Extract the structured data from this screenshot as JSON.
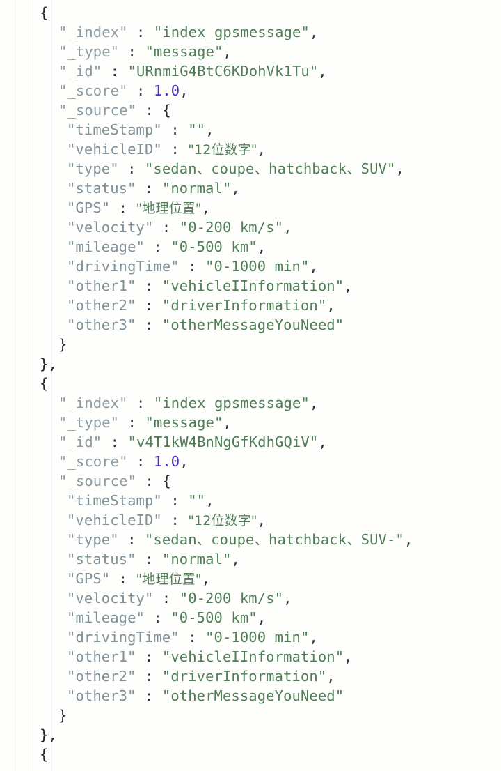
{
  "viewer": {
    "name": "json-result-viewer",
    "language": "json",
    "background_color": "#fefffd",
    "colors": {
      "key": "#8b9aa3",
      "key_nested": "#7f9098",
      "string": "#4f7d55",
      "number": "#4b2bc4",
      "punctuation": "#2d3338",
      "brace": "#22282d",
      "indent_guide": "#eef0f1"
    }
  },
  "documents": [
    {
      "open_brace": "{",
      "fields": [
        {
          "key": "\"_index\"",
          "colon": " : ",
          "value": "\"index_gpsmessage\"",
          "comma": ",",
          "kind": "string"
        },
        {
          "key": "\"_type\"",
          "colon": " : ",
          "value": "\"message\"",
          "comma": ",",
          "kind": "string"
        },
        {
          "key": "\"_id\"",
          "colon": " : ",
          "value": "\"URnmiG4BtC6KDohVk1Tu\"",
          "comma": ",",
          "kind": "string"
        },
        {
          "key": "\"_score\"",
          "colon": " : ",
          "value": "1.0",
          "comma": ",",
          "kind": "number"
        },
        {
          "key": "\"_source\"",
          "colon": " : ",
          "value": "{",
          "comma": "",
          "kind": "object-open"
        }
      ],
      "source": [
        {
          "key": "\"timeStamp\"",
          "colon": " : ",
          "value": "\"\"",
          "comma": ",",
          "kind": "string"
        },
        {
          "key": "\"vehicleID\"",
          "colon": " : ",
          "value": "\"12位数字\"",
          "comma": ",",
          "kind": "string-cjk"
        },
        {
          "key": "\"type\"",
          "colon": " : ",
          "value": "\"sedan、coupe、hatchback、SUV\"",
          "comma": ",",
          "kind": "string"
        },
        {
          "key": "\"status\"",
          "colon": " : ",
          "value": "\"normal\"",
          "comma": ",",
          "kind": "string"
        },
        {
          "key": "\"GPS\"",
          "colon": " : ",
          "value": "\"地理位置\"",
          "comma": ",",
          "kind": "string-cjk"
        },
        {
          "key": "\"velocity\"",
          "colon": " : ",
          "value": "\"0-200 km/s\"",
          "comma": ",",
          "kind": "string"
        },
        {
          "key": "\"mileage\"",
          "colon": " : ",
          "value": "\"0-500 km\"",
          "comma": ",",
          "kind": "string"
        },
        {
          "key": "\"drivingTime\"",
          "colon": " : ",
          "value": "\"0-1000 min\"",
          "comma": ",",
          "kind": "string"
        },
        {
          "key": "\"other1\"",
          "colon": " : ",
          "value": "\"vehicleIInformation\"",
          "comma": ",",
          "kind": "string"
        },
        {
          "key": "\"other2\"",
          "colon": " : ",
          "value": "\"driverInformation\"",
          "comma": ",",
          "kind": "string"
        },
        {
          "key": "\"other3\"",
          "colon": " : ",
          "value": "\"otherMessageYouNeed\"",
          "comma": "",
          "kind": "string"
        }
      ],
      "source_close": "}",
      "close_brace": "},"
    },
    {
      "open_brace": "{",
      "fields": [
        {
          "key": "\"_index\"",
          "colon": " : ",
          "value": "\"index_gpsmessage\"",
          "comma": ",",
          "kind": "string"
        },
        {
          "key": "\"_type\"",
          "colon": " : ",
          "value": "\"message\"",
          "comma": ",",
          "kind": "string"
        },
        {
          "key": "\"_id\"",
          "colon": " : ",
          "value": "\"v4T1kW4BnNgGfKdhGQiV\"",
          "comma": ",",
          "kind": "string"
        },
        {
          "key": "\"_score\"",
          "colon": " : ",
          "value": "1.0",
          "comma": ",",
          "kind": "number"
        },
        {
          "key": "\"_source\"",
          "colon": " : ",
          "value": "{",
          "comma": "",
          "kind": "object-open"
        }
      ],
      "source": [
        {
          "key": "\"timeStamp\"",
          "colon": " : ",
          "value": "\"\"",
          "comma": ",",
          "kind": "string"
        },
        {
          "key": "\"vehicleID\"",
          "colon": " : ",
          "value": "\"12位数字\"",
          "comma": ",",
          "kind": "string-cjk"
        },
        {
          "key": "\"type\"",
          "colon": " : ",
          "value": "\"sedan、coupe、hatchback、SUV-\"",
          "comma": ",",
          "kind": "string"
        },
        {
          "key": "\"status\"",
          "colon": " : ",
          "value": "\"normal\"",
          "comma": ",",
          "kind": "string"
        },
        {
          "key": "\"GPS\"",
          "colon": " : ",
          "value": "\"地理位置\"",
          "comma": ",",
          "kind": "string-cjk"
        },
        {
          "key": "\"velocity\"",
          "colon": " : ",
          "value": "\"0-200 km/s\"",
          "comma": ",",
          "kind": "string"
        },
        {
          "key": "\"mileage\"",
          "colon": " : ",
          "value": "\"0-500 km\"",
          "comma": ",",
          "kind": "string"
        },
        {
          "key": "\"drivingTime\"",
          "colon": " : ",
          "value": "\"0-1000 min\"",
          "comma": ",",
          "kind": "string"
        },
        {
          "key": "\"other1\"",
          "colon": " : ",
          "value": "\"vehicleIInformation\"",
          "comma": ",",
          "kind": "string"
        },
        {
          "key": "\"other2\"",
          "colon": " : ",
          "value": "\"driverInformation\"",
          "comma": ",",
          "kind": "string"
        },
        {
          "key": "\"other3\"",
          "colon": " : ",
          "value": "\"otherMessageYouNeed\"",
          "comma": "",
          "kind": "string"
        }
      ],
      "source_close": "}",
      "close_brace": "},"
    }
  ],
  "trailing": {
    "next_open_brace": "{"
  }
}
